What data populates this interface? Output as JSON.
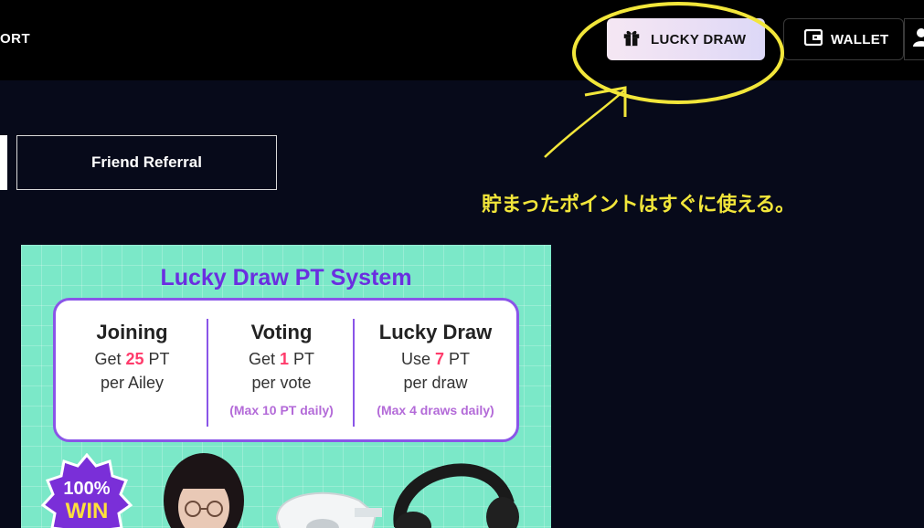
{
  "header": {
    "nav_partial": "ORT",
    "lucky_draw_label": "LUCKY DRAW",
    "wallet_label": "WALLET"
  },
  "tabs": {
    "referral_label": "Friend Referral"
  },
  "annotation": {
    "text": "貯まったポイントはすぐに使える。",
    "color": "#f2e63a"
  },
  "banner": {
    "title": "Lucky Draw PT System",
    "columns": [
      {
        "title": "Joining",
        "line1_pre": "Get ",
        "line1_num": "25",
        "line1_post": " PT",
        "line2": "per Ailey",
        "note": ""
      },
      {
        "title": "Voting",
        "line1_pre": "Get ",
        "line1_num": "1",
        "line1_post": " PT",
        "line2": "per vote",
        "note": "(Max 10 PT daily)"
      },
      {
        "title": "Lucky Draw",
        "line1_pre": "Use ",
        "line1_num": "7",
        "line1_post": " PT",
        "line2": "per draw",
        "note": "(Max 4 draws daily)"
      }
    ],
    "badge_line1": "100%",
    "badge_line2": "WIN"
  },
  "colors": {
    "accent_purple": "#8a55e8",
    "pt_highlight": "#ff3b6b",
    "banner_bg": "#7be8c8"
  }
}
